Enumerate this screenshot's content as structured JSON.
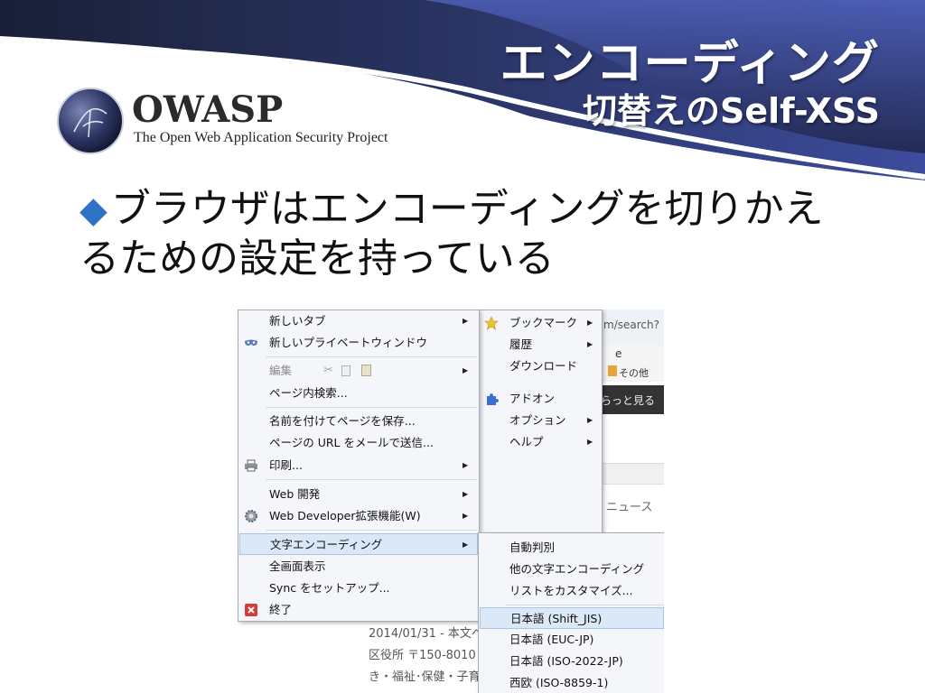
{
  "slide": {
    "title_line1": "エンコーディング",
    "title_line2": "切替えのSelf-XSS",
    "bullet_mark": "◆",
    "bullet_text": "ブラウザはエンコーディングを切りかえるための設定を持っている"
  },
  "logo": {
    "name": "OWASP",
    "subtitle": "The Open Web Application Security Project"
  },
  "colors": {
    "header_dark": "#1f2440",
    "header_accent": "#3a4a9a",
    "bullet_blue": "#2f71c4",
    "menu_bg": "#f4f6f9",
    "highlight": "#dbe8f8"
  },
  "main_menu": {
    "items": [
      {
        "label": "新しいタブ",
        "icon": "none",
        "submenu": true
      },
      {
        "label": "新しいプライベートウィンドウ",
        "icon": "mask-icon",
        "submenu": false
      },
      {
        "label": "編集",
        "icon": "none",
        "submenu": true,
        "disabled": true
      },
      {
        "label": "ページ内検索...",
        "icon": "none",
        "submenu": false
      },
      {
        "label": "名前を付けてページを保存...",
        "icon": "none",
        "submenu": false
      },
      {
        "label": "ページの URL をメールで送信...",
        "icon": "none",
        "submenu": false
      },
      {
        "label": "印刷...",
        "icon": "printer-icon",
        "submenu": true
      },
      {
        "label": "Web 開発",
        "icon": "none",
        "submenu": true
      },
      {
        "label": "Web Developer拡張機能(W)",
        "icon": "gear-icon",
        "submenu": true
      },
      {
        "label": "文字エンコーディング",
        "icon": "none",
        "submenu": true
      },
      {
        "label": "全画面表示",
        "icon": "none",
        "submenu": false
      },
      {
        "label": "Sync をセットアップ...",
        "icon": "none",
        "submenu": false
      },
      {
        "label": "終了",
        "icon": "exit-icon",
        "submenu": false
      }
    ]
  },
  "right_menu": {
    "items": [
      {
        "label": "ブックマーク",
        "icon": "star-icon",
        "submenu": true
      },
      {
        "label": "履歴",
        "icon": "none",
        "submenu": true
      },
      {
        "label": "ダウンロード",
        "icon": "none",
        "submenu": false
      },
      {
        "label": "アドオン",
        "icon": "puzzle-icon",
        "submenu": false
      },
      {
        "label": "オプション",
        "icon": "none",
        "submenu": true
      },
      {
        "label": "ヘルプ",
        "icon": "none",
        "submenu": true
      }
    ]
  },
  "encoding_menu": {
    "items": [
      {
        "label": "自動判別"
      },
      {
        "label": "他の文字エンコーディング"
      },
      {
        "label": "リストをカスタマイズ..."
      },
      {
        "label": "日本語 (Shift_JIS)"
      },
      {
        "label": "日本語 (EUC-JP)"
      },
      {
        "label": "日本語 (ISO-2022-JP)"
      },
      {
        "label": "西欧 (ISO-8859-1)"
      }
    ]
  },
  "background": {
    "url_fragment": "m/search?",
    "toolbar_e": "e",
    "toolbar_more": "その他",
    "more_link": "らっと見る",
    "news": "ニュース",
    "text_line1": "2014/01/31 - 本文へ",
    "text_line2": "区役所 〒150-8010",
    "text_line3": "き・福祉･保健・子育"
  }
}
